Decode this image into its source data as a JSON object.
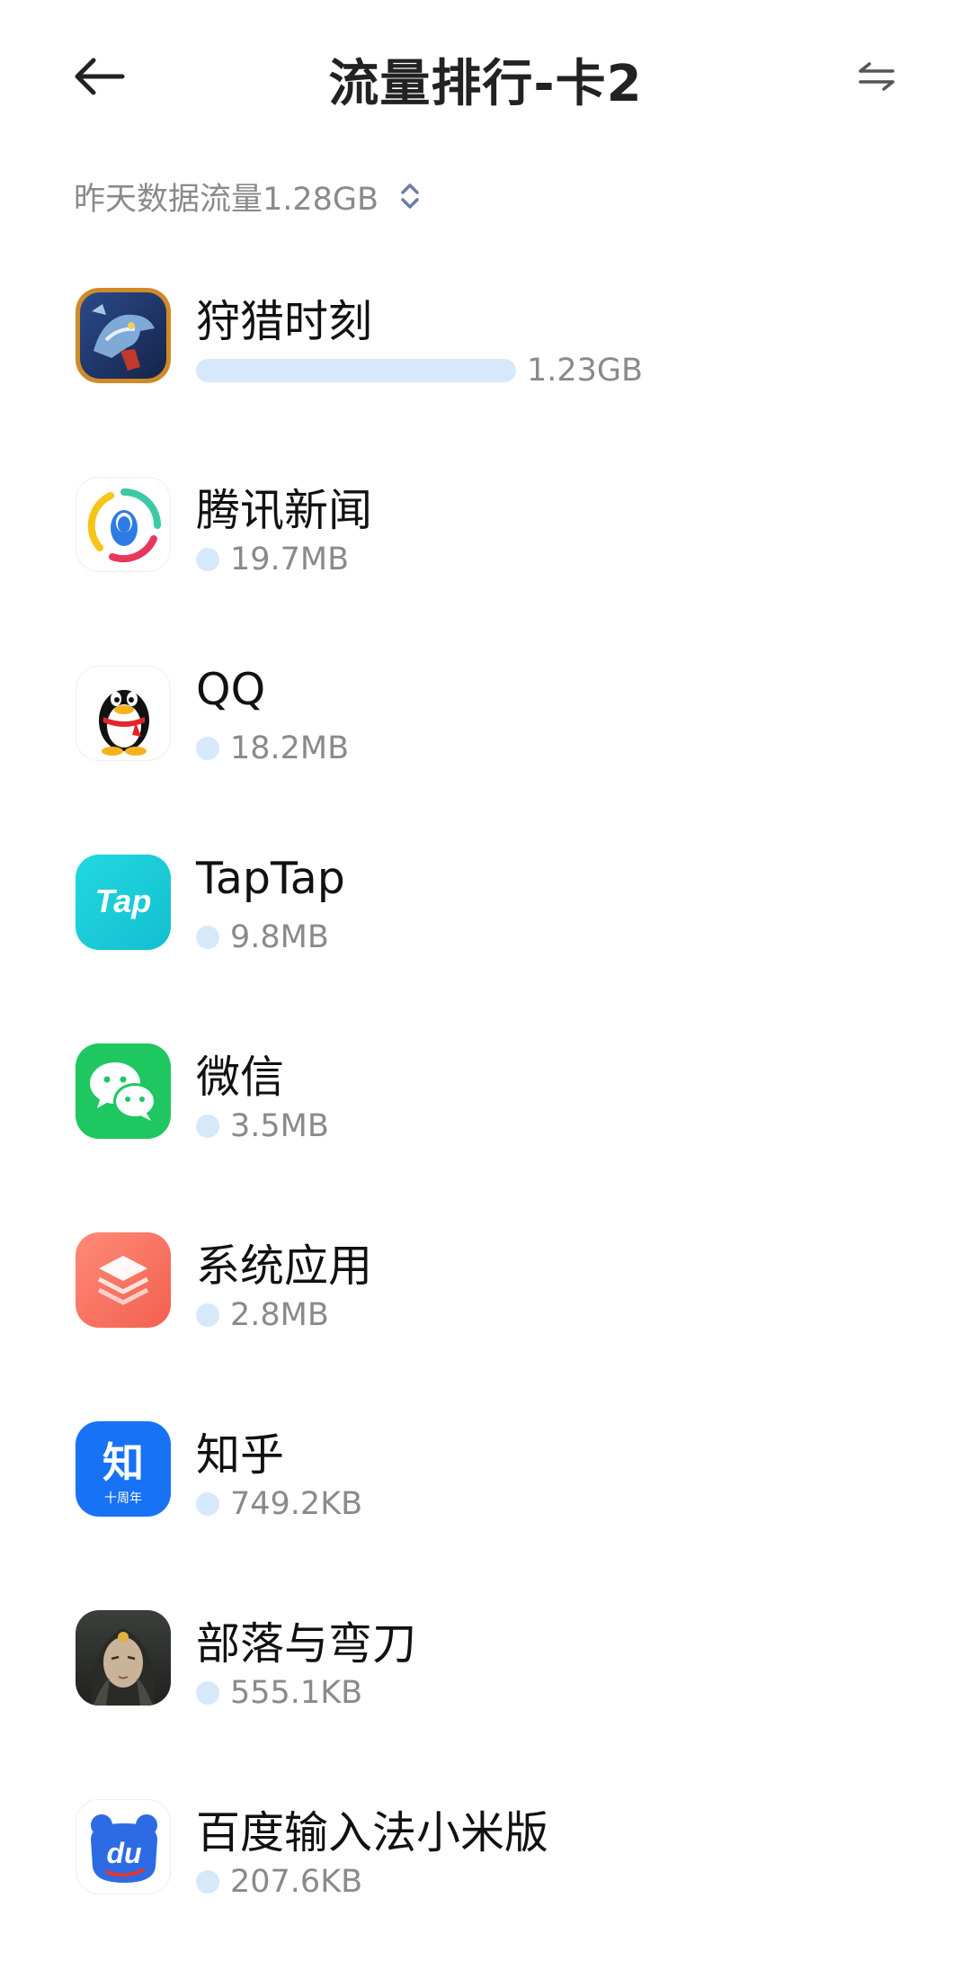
{
  "header": {
    "title": "流量排行-卡2"
  },
  "summary": {
    "text": "昨天数据流量1.28GB"
  },
  "apps": [
    {
      "name": "狩猎时刻",
      "usage": "1.23GB",
      "fraction": 1.0
    },
    {
      "name": "腾讯新闻",
      "usage": "19.7MB",
      "fraction": 0.016
    },
    {
      "name": "QQ",
      "usage": "18.2MB",
      "fraction": 0.015
    },
    {
      "name": "TapTap",
      "usage": "9.8MB",
      "fraction": 0.008
    },
    {
      "name": "微信",
      "usage": "3.5MB",
      "fraction": 0.003
    },
    {
      "name": "系统应用",
      "usage": "2.8MB",
      "fraction": 0.002
    },
    {
      "name": "知乎",
      "usage": "749.2KB",
      "fraction": 0.0006
    },
    {
      "name": "部落与弯刀",
      "usage": "555.1KB",
      "fraction": 0.0004
    },
    {
      "name": "百度输入法小米版",
      "usage": "207.6KB",
      "fraction": 0.0002
    }
  ],
  "icons": {
    "tap_text": "Tap",
    "zhihu_text": "知",
    "zhihu_sub": "十周年",
    "baidu_text": "du"
  },
  "colors": {
    "bar": "#d5e9fb",
    "title": "#222222",
    "secondary": "#8a8a8a"
  }
}
